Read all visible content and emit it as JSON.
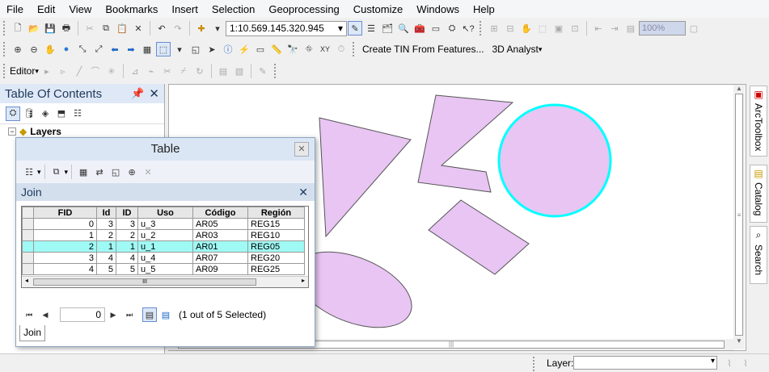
{
  "menu": [
    "File",
    "Edit",
    "View",
    "Bookmarks",
    "Insert",
    "Selection",
    "Geoprocessing",
    "Customize",
    "Windows",
    "Help"
  ],
  "toolbar": {
    "scale": "1:10.569.145.320.945",
    "zoom_percent": "100%",
    "tin_tool": "Create TIN From Features...",
    "analyst": "3D Analyst",
    "editor": "Editor"
  },
  "toc": {
    "title": "Table Of Contents",
    "layers_label": "Layers"
  },
  "right_dock": {
    "toolbox": "ArcToolbox",
    "catalog": "Catalog",
    "search": "Search"
  },
  "status": {
    "layer_label": "Layer:"
  },
  "table_window": {
    "title": "Table",
    "join_tab_header": "Join",
    "columns": [
      "FID",
      "Id",
      "ID",
      "Uso",
      "Código",
      "Región"
    ],
    "rows": [
      [
        "0",
        "3",
        "3",
        "u_3",
        "AR05",
        "REG15"
      ],
      [
        "1",
        "2",
        "2",
        "u_2",
        "AR03",
        "REG10"
      ],
      [
        "2",
        "1",
        "1",
        "u_1",
        "AR01",
        "REG05"
      ],
      [
        "3",
        "4",
        "4",
        "u_4",
        "AR07",
        "REG20"
      ],
      [
        "4",
        "5",
        "5",
        "u_5",
        "AR09",
        "REG25"
      ]
    ],
    "selected_row": 2,
    "record_number": "0",
    "selection_text": "(1 out of 5 Selected)",
    "bottom_tab": "Join",
    "scroll_marker": "III"
  },
  "map_colors": {
    "fill": "#e8c5f3",
    "outline": "#555555",
    "selected_outline": "#00ffff"
  }
}
